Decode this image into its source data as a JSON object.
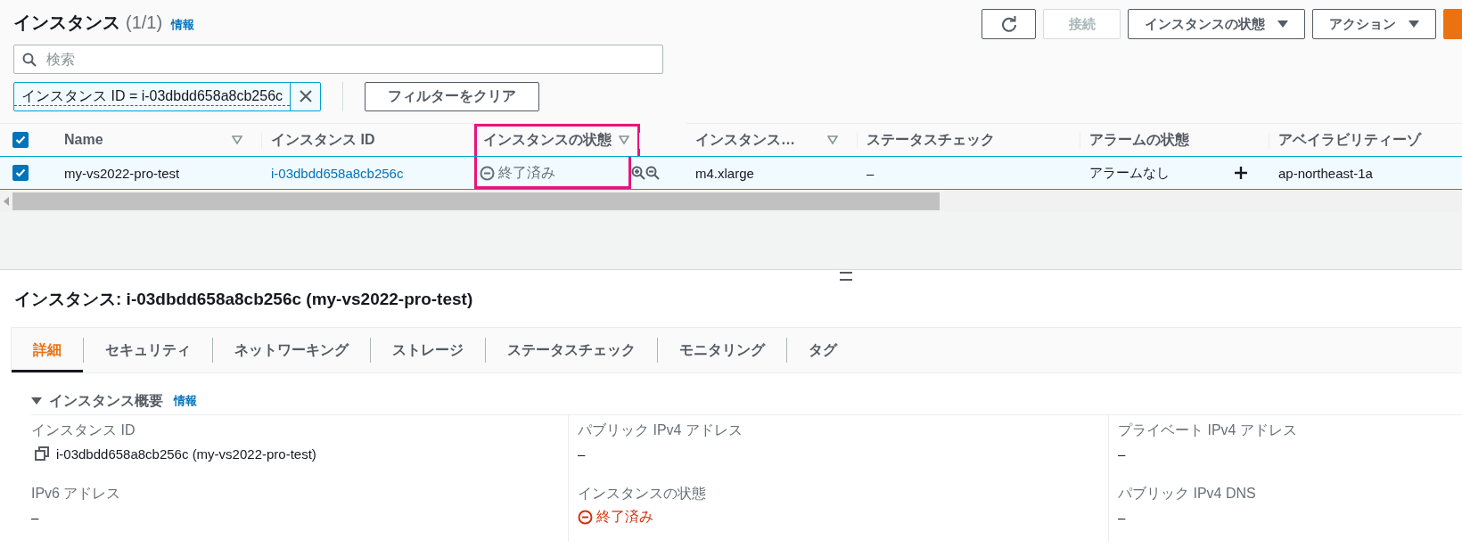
{
  "list": {
    "title": "インスタンス",
    "count": "(1/1)",
    "info": "情報",
    "buttons": [
      {
        "kind": "refresh",
        "disabled": false
      },
      {
        "kind": "text",
        "label": "接続",
        "disabled": true
      },
      {
        "kind": "menu",
        "label": "インスタンスの状態",
        "disabled": false
      },
      {
        "kind": "menu",
        "label": "アクション",
        "disabled": false
      },
      {
        "kind": "primary",
        "disabled": false
      }
    ],
    "search": {
      "placeholder": "検索"
    },
    "filter_token": "インスタンス ID = i-03dbdd658a8cb256c",
    "clear_filters": "フィルターをクリア"
  },
  "table": {
    "select_all_checked": true,
    "columns": [
      {
        "label": "Name",
        "filterable": true,
        "highlighted": false
      },
      {
        "label": "インスタンス ID",
        "filterable": false,
        "highlighted": false
      },
      {
        "label": "インスタンスの状態",
        "filterable": true,
        "highlighted": true
      },
      {
        "label": "インスタンス…",
        "filterable": true,
        "highlighted": false
      },
      {
        "label": "ステータスチェック",
        "filterable": false,
        "highlighted": false
      },
      {
        "label": "アラームの状態",
        "filterable": false,
        "highlighted": false
      },
      {
        "label": "アベイラビリティーゾ",
        "filterable": false,
        "highlighted": false
      }
    ],
    "rows": [
      {
        "selected": true,
        "cells": [
          {
            "kind": "text",
            "text": "my-vs2022-pro-test"
          },
          {
            "kind": "link",
            "text": "i-03dbdd658a8cb256c"
          },
          {
            "kind": "status",
            "text": "終了済み"
          },
          {
            "kind": "text",
            "text": "m4.xlarge"
          },
          {
            "kind": "text",
            "text": "–"
          },
          {
            "kind": "alarm",
            "text": "アラームなし"
          },
          {
            "kind": "text",
            "text": "ap-northeast-1a"
          }
        ]
      }
    ]
  },
  "details": {
    "title": "インスタンス: i-03dbdd658a8cb256c (my-vs2022-pro-test)",
    "tabs": [
      {
        "label": "詳細",
        "selected": true
      },
      {
        "label": "セキュリティ",
        "selected": false
      },
      {
        "label": "ネットワーキング",
        "selected": false
      },
      {
        "label": "ストレージ",
        "selected": false
      },
      {
        "label": "ステータスチェック",
        "selected": false
      },
      {
        "label": "モニタリング",
        "selected": false
      },
      {
        "label": "タグ",
        "selected": false
      }
    ],
    "section": {
      "title": "インスタンス概要",
      "info": "情報",
      "expanded": true
    },
    "fields": [
      {
        "label": "インスタンス ID",
        "kind": "copy",
        "value": "i-03dbdd658a8cb256c (my-vs2022-pro-test)"
      },
      {
        "label": "パブリック IPv4 アドレス",
        "kind": "text",
        "value": "–"
      },
      {
        "label": "プライベート IPv4 アドレス",
        "kind": "text",
        "value": "–"
      },
      {
        "label": "IPv6 アドレス",
        "kind": "text",
        "value": "–"
      },
      {
        "label": "インスタンスの状態",
        "kind": "status",
        "value": "終了済み"
      },
      {
        "label": "パブリック IPv4 DNS",
        "kind": "text",
        "value": "–"
      }
    ]
  }
}
